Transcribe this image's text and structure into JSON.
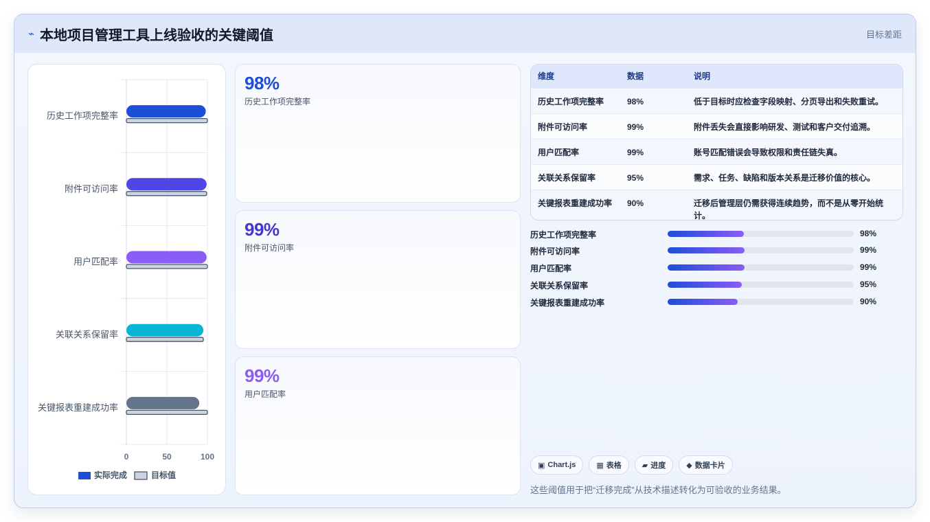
{
  "header": {
    "logo_glyph": "⌁",
    "title": "本地项目管理工具上线验收的关键阈值",
    "right_label": "目标差距"
  },
  "chart_data": {
    "type": "bar",
    "orientation": "horizontal",
    "categories": [
      "历史工作项完整率",
      "附件可访问率",
      "用户匹配率",
      "关联关系保留率",
      "关键报表重建成功率"
    ],
    "series": [
      {
        "name": "实际完成",
        "values": [
          98,
          99,
          99,
          95,
          90
        ],
        "colors": [
          "#1d4ed8",
          "#4f46e5",
          "#8b5cf6",
          "#06b6d4",
          "#64748b"
        ]
      },
      {
        "name": "目标值",
        "values": [
          100,
          99,
          100,
          95,
          100
        ],
        "color": "#cbd5e1",
        "stroke": "#475569"
      }
    ],
    "xlim": [
      0,
      100
    ],
    "xticks": [
      "0",
      "50",
      "100"
    ],
    "grid": true,
    "legend": "bottom"
  },
  "cards": [
    {
      "value": "98%",
      "label": "历史工作项完整率",
      "color": "#1d4ed8"
    },
    {
      "value": "99%",
      "label": "附件可访问率",
      "color": "#4338ca"
    },
    {
      "value": "99%",
      "label": "用户匹配率",
      "color": "#8b5cf6"
    }
  ],
  "table": {
    "headers": [
      "维度",
      "数据",
      "说明"
    ],
    "rows": [
      {
        "dim": "历史工作项完整率",
        "val": "98%",
        "desc": "低于目标时应检查字段映射、分页导出和失败重试。"
      },
      {
        "dim": "附件可访问率",
        "val": "99%",
        "desc": "附件丢失会直接影响研发、测试和客户交付追溯。"
      },
      {
        "dim": "用户匹配率",
        "val": "99%",
        "desc": "账号匹配错误会导致权限和责任链失真。"
      },
      {
        "dim": "关联关系保留率",
        "val": "95%",
        "desc": "需求、任务、缺陷和版本关系是迁移价值的核心。"
      },
      {
        "dim": "关键报表重建成功率",
        "val": "90%",
        "desc": "迁移后管理层仍需获得连续趋势，而不是从零开始统计。"
      }
    ]
  },
  "progress": [
    {
      "label": "历史工作项完整率",
      "value": "98%",
      "fraction": 0.41
    },
    {
      "label": "附件可访问率",
      "value": "99%",
      "fraction": 0.415
    },
    {
      "label": "用户匹配率",
      "value": "99%",
      "fraction": 0.415
    },
    {
      "label": "关联关系保留率",
      "value": "95%",
      "fraction": 0.398
    },
    {
      "label": "关键报表重建成功率",
      "value": "90%",
      "fraction": 0.377
    }
  ],
  "chips": [
    {
      "icon": "▣",
      "label": "Chart.js"
    },
    {
      "icon": "▦",
      "label": "表格"
    },
    {
      "icon": "▰",
      "label": "进度"
    },
    {
      "icon": "◆",
      "label": "数据卡片"
    }
  ],
  "footer": {
    "note": "这些阈值用于把“迁移完成”从技术描述转化为可验收的业务结果。"
  }
}
